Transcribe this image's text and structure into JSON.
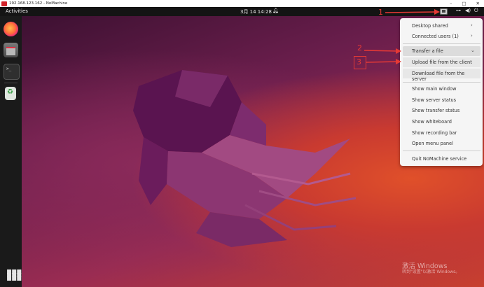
{
  "window": {
    "title": "192.168.123.162 - NoMachine",
    "controls": {
      "minimize": "–",
      "maximize": "□",
      "close": "✕"
    }
  },
  "topbar": {
    "activities": "Activities",
    "clock": "3月 14  14:28"
  },
  "icons": {
    "bell": "bell-icon",
    "nx": "nomachine-tray-icon",
    "net": "network-icon",
    "vol": "volume-icon",
    "power": "power-icon"
  },
  "menu": {
    "items": [
      {
        "label": "Desktop shared",
        "chevron": "›"
      },
      {
        "label": "Connected users (1)",
        "chevron": "›"
      },
      {
        "label": "Transfer a file",
        "chevron": "⌄"
      },
      {
        "label": "Upload file from the client"
      },
      {
        "label": "Download file from the server"
      },
      {
        "label": "Show main window"
      },
      {
        "label": "Show server status"
      },
      {
        "label": "Show transfer status"
      },
      {
        "label": "Show whiteboard"
      },
      {
        "label": "Show recording bar"
      },
      {
        "label": "Open menu panel"
      },
      {
        "label": "Quit NoMachine service"
      }
    ]
  },
  "annotations": {
    "n1": "1",
    "n2": "2",
    "n3": "3",
    "color": "#e53935"
  },
  "watermark": {
    "title": "激活 Windows",
    "subtitle": "转到\"设置\"以激活 Windows。"
  }
}
